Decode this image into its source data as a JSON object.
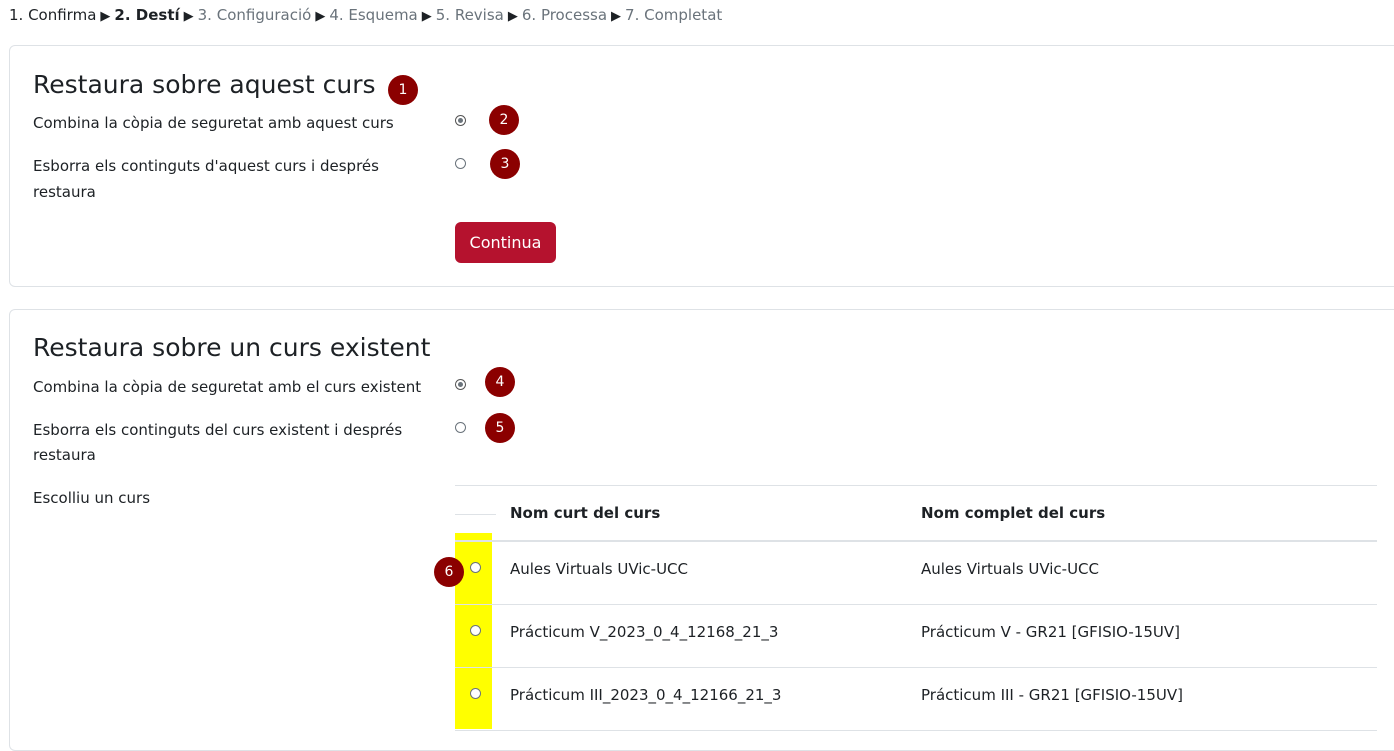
{
  "breadcrumb": {
    "steps": [
      {
        "label": "1. Confirma"
      },
      {
        "label": "2. Destí"
      },
      {
        "label": "3. Configuració"
      },
      {
        "label": "4. Esquema"
      },
      {
        "label": "5. Revisa"
      },
      {
        "label": "6. Processa"
      },
      {
        "label": "7. Completat"
      }
    ],
    "separator": "▶"
  },
  "this_course": {
    "title": "Restaura sobre aquest curs",
    "option_merge": "Combina la còpia de seguretat amb aquest curs",
    "option_delete_line1": "Esborra els continguts d'aquest curs i després",
    "option_delete_line2": "restaura",
    "continue_label": "Continua"
  },
  "existing_course": {
    "title": "Restaura sobre un curs existent",
    "option_merge": "Combina la còpia de seguretat amb el curs existent",
    "option_delete_line1": "Esborra els continguts del curs existent i després",
    "option_delete_line2": "restaura",
    "choose_label": "Escolliu un curs",
    "table": {
      "col_short": "Nom curt del curs",
      "col_full": "Nom complet del curs",
      "rows": [
        {
          "short": "Aules Virtuals UVic-UCC",
          "full": "Aules Virtuals UVic-UCC"
        },
        {
          "short": "Prácticum V_2023_0_4_12168_21_3",
          "full": "Prácticum V - GR21 [GFISIO-15UV]"
        },
        {
          "short": "Prácticum III_2023_0_4_12166_21_3",
          "full": "Prácticum III - GR21 [GFISIO-15UV]"
        }
      ]
    }
  },
  "badges": [
    "1",
    "2",
    "3",
    "4",
    "5",
    "6"
  ],
  "colors": {
    "accent_button": "#b5122e",
    "badge": "#8b0000",
    "highlight": "#ffff00"
  }
}
